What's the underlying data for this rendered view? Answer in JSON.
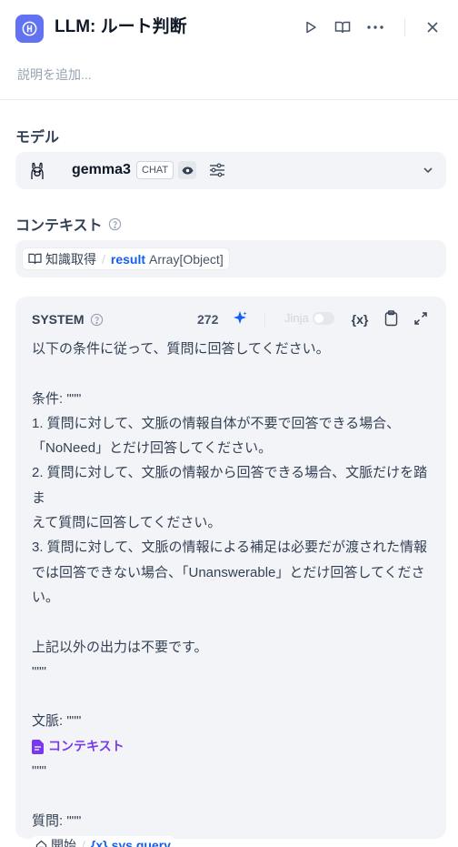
{
  "header": {
    "title": "LLM: ルート判断",
    "description_placeholder": "説明を追加..."
  },
  "model": {
    "section_label": "モデル",
    "name": "gemma3",
    "mode_badge": "CHAT"
  },
  "context": {
    "section_label": "コンテキスト",
    "node": "知識取得",
    "variable": "result",
    "type": "Array[Object]"
  },
  "system_prompt": {
    "role": "SYSTEM",
    "token_count": "272",
    "jinja_label": "Jinja",
    "variable_label": "{x}",
    "lines": [
      "以下の条件に従って、質問に回答してください。",
      "",
      "条件: \"\"\"",
      "1. 質問に対して、文脈の情報自体が不要で回答できる場合、",
      "「NoNeed」とだけ回答してください。",
      "2. 質問に対して、文脈の情報から回答できる場合、文脈だけを踏ま",
      "えて質問に回答してください。",
      "3. 質問に対して、文脈の情報による補足は必要だが渡された情報",
      "では回答できない場合、「Unanswerable」とだけ回答してください。",
      "",
      "上記以外の出力は不要です。",
      "\"\"\"",
      "",
      "文脈: \"\"\""
    ],
    "context_var_label": "コンテキスト",
    "after_context": [
      "\"\"\"",
      "",
      "質問: \"\"\""
    ],
    "query_node": "開始",
    "query_var": "sys.query",
    "closing": "\"\"\""
  },
  "colors": {
    "accent": "#6172f3",
    "variable_blue": "#155eef",
    "context_purple": "#7839ee",
    "panel_bg": "#f2f4f7"
  }
}
